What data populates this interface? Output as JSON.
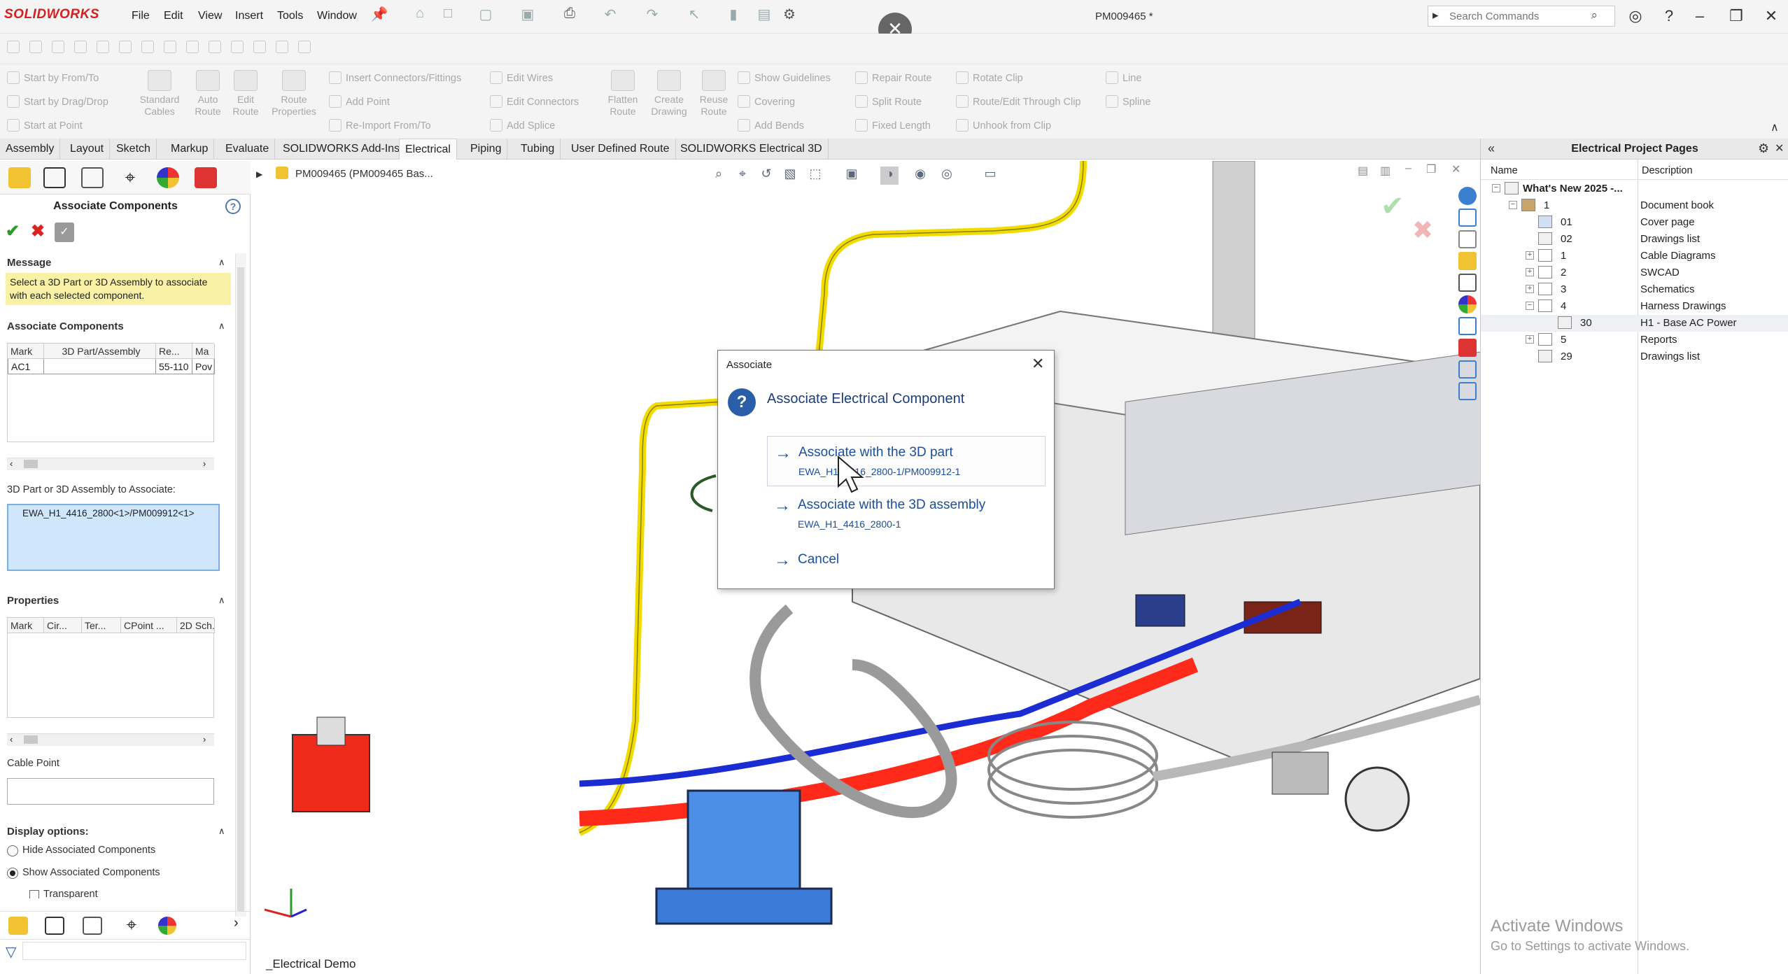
{
  "app": {
    "logo": "SOLIDWORKS",
    "document_title": "PM009465 *",
    "menu": [
      "File",
      "Edit",
      "View",
      "Insert",
      "Tools",
      "Window"
    ],
    "search_placeholder": "Search Commands"
  },
  "ribbon": {
    "small_buttons": [
      "Start by From/To",
      "Start by Drag/Drop",
      "Start at Point",
      "Insert Connectors/Fittings",
      "Add Point",
      "Re-Import From/To",
      "Edit Wires",
      "Edit Connectors",
      "Add Splice",
      "Show Guidelines",
      "Covering",
      "Add Bends",
      "Repair Route",
      "Split Route",
      "Fixed Length",
      "Rotate Clip",
      "Route/Edit Through Clip",
      "Unhook from Clip",
      "Line",
      "Spline"
    ],
    "large_buttons": [
      [
        "Standard",
        "Cables"
      ],
      [
        "Auto",
        "Route"
      ],
      [
        "Edit",
        "Route"
      ],
      [
        "Route",
        "Properties"
      ],
      [
        "Flatten",
        "Route"
      ],
      [
        "Create",
        "Drawing"
      ],
      [
        "Reuse",
        "Route"
      ]
    ]
  },
  "tabs": [
    "Assembly",
    "Layout",
    "Sketch",
    "Markup",
    "Evaluate",
    "SOLIDWORKS Add-Ins",
    "Electrical",
    "Piping",
    "Tubing",
    "User Defined Route",
    "SOLIDWORKS Electrical 3D"
  ],
  "left_panel": {
    "title": "Associate Components",
    "message_header": "Message",
    "message_line1": "Select a 3D Part or 3D Assembly to associate",
    "message_line2": "with each selected component.",
    "assoc_header": "Associate Components",
    "assoc_columns": [
      "Mark",
      "3D Part/Assembly",
      "Re...",
      "Ma"
    ],
    "assoc_row": [
      "AC1",
      "",
      "55-110",
      "Pov"
    ],
    "part_label": "3D Part or 3D Assembly to Associate:",
    "part_value": "EWA_H1_4416_2800<1>/PM009912<1>",
    "properties_header": "Properties",
    "properties_columns": [
      "Mark",
      "Cir...",
      "Ter...",
      "CPoint ...",
      "2D Sch."
    ],
    "cable_point_label": "Cable Point",
    "display_header": "Display options:",
    "radio_hide": "Hide Associated Components",
    "radio_show": "Show Associated Components",
    "checkbox_transparent": "Transparent"
  },
  "viewport": {
    "breadcrumb": "PM009465 (PM009465 Bas...",
    "bottom_label": "_Electrical Demo"
  },
  "dialog": {
    "title": "Associate",
    "heading": "Associate Electrical Component",
    "option1_main": "Associate with the 3D part",
    "option1_sub": "EWA_H1_4416_2800-1/PM009912-1",
    "option2_main": "Associate with the 3D assembly",
    "option2_sub": "EWA_H1_4416_2800-1",
    "cancel": "Cancel"
  },
  "right_panel": {
    "title": "Electrical Project Pages",
    "col_name": "Name",
    "col_desc": "Description",
    "rows": [
      {
        "name": "What's New 2025 -...",
        "desc": ""
      },
      {
        "name": "1",
        "desc": "Document book"
      },
      {
        "name": "01",
        "desc": "Cover page"
      },
      {
        "name": "02",
        "desc": "Drawings list"
      },
      {
        "name": "1",
        "desc": "Cable Diagrams"
      },
      {
        "name": "2",
        "desc": "SWCAD"
      },
      {
        "name": "3",
        "desc": "Schematics"
      },
      {
        "name": "4",
        "desc": "Harness Drawings"
      },
      {
        "name": "30",
        "desc": "H1 - Base AC Power"
      },
      {
        "name": "5",
        "desc": "Reports"
      },
      {
        "name": "29",
        "desc": "Drawings list"
      }
    ]
  },
  "watermark": {
    "line1": "Activate Windows",
    "line2": "Go to Settings to activate Windows."
  },
  "colors": {
    "brand_red": "#d42020",
    "dialog_blue": "#1a4f9c",
    "message_yellow": "#f9f1a5",
    "selection_blue": "#cfe6fb"
  }
}
